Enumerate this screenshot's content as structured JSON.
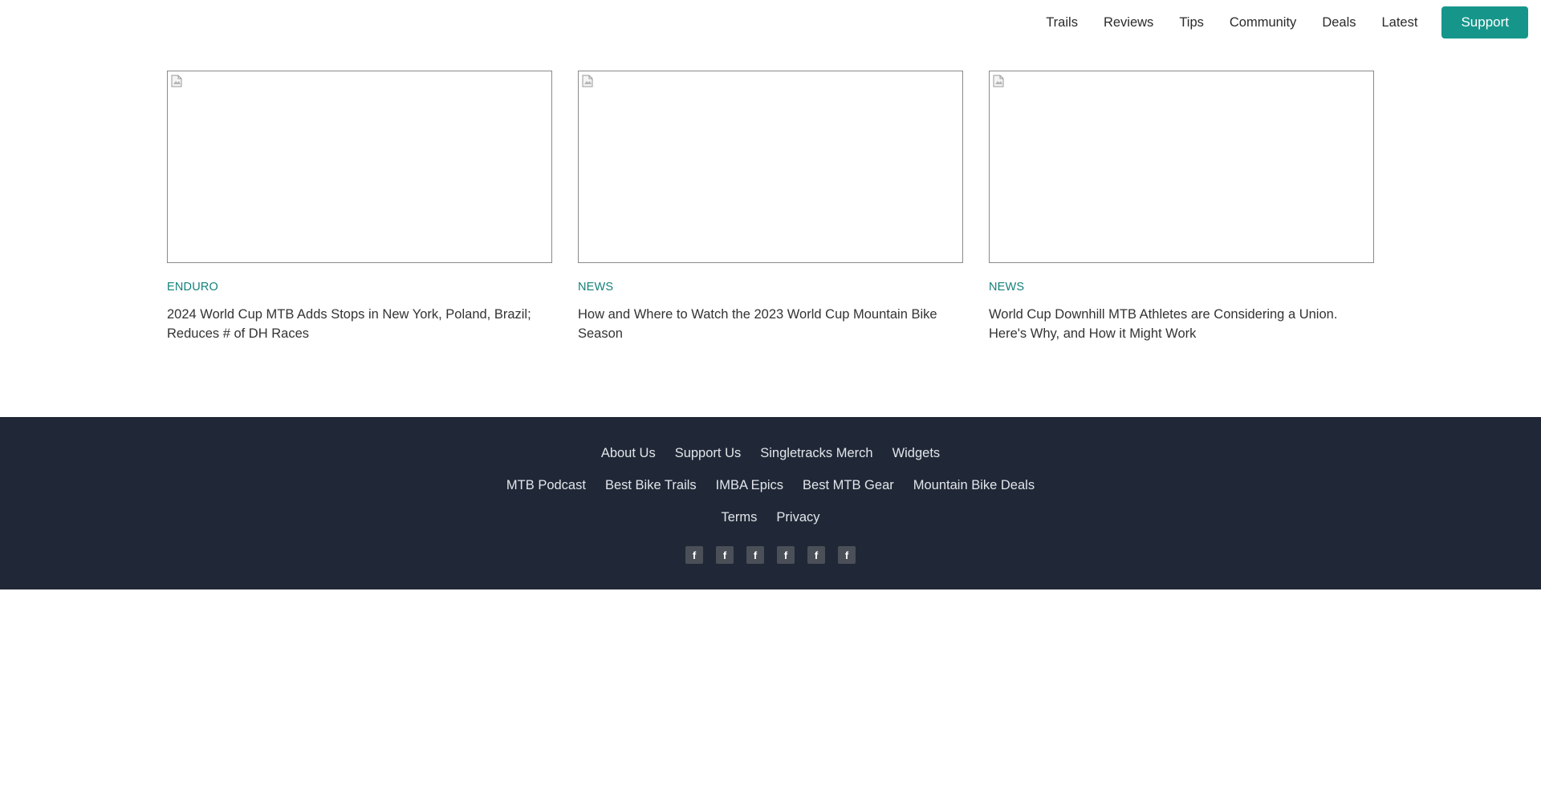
{
  "header": {
    "nav": [
      {
        "label": "Trails"
      },
      {
        "label": "Reviews"
      },
      {
        "label": "Tips"
      },
      {
        "label": "Community"
      },
      {
        "label": "Deals"
      },
      {
        "label": "Latest"
      }
    ],
    "support_label": "Support",
    "accent_color": "#16968b"
  },
  "articles": [
    {
      "category": "ENDURO",
      "title": "2024 World Cup MTB Adds Stops in New York, Poland, Brazil; Reduces # of DH Races",
      "image_icon": "broken-image-icon"
    },
    {
      "category": "NEWS",
      "title": "How and Where to Watch the 2023 World Cup Mountain Bike Season",
      "image_icon": "broken-image-icon"
    },
    {
      "category": "NEWS",
      "title": "World Cup Downhill MTB Athletes are Considering a Union. Here's Why, and How it Might Work",
      "image_icon": "broken-image-icon"
    }
  ],
  "footer": {
    "background_color": "#202837",
    "row1": [
      "About Us",
      "Support Us",
      "Singletracks Merch",
      "Widgets"
    ],
    "row2": [
      "MTB Podcast",
      "Best Bike Trails",
      "IMBA Epics",
      "Best MTB Gear",
      "Mountain Bike Deals"
    ],
    "row3": [
      "Terms",
      "Privacy"
    ],
    "social": [
      {
        "glyph": "f",
        "icon": "facebook-icon"
      },
      {
        "glyph": "f",
        "icon": "facebook-icon"
      },
      {
        "glyph": "f",
        "icon": "facebook-icon"
      },
      {
        "glyph": "f",
        "icon": "facebook-icon"
      },
      {
        "glyph": "f",
        "icon": "facebook-icon"
      },
      {
        "glyph": "f",
        "icon": "facebook-icon"
      }
    ]
  }
}
